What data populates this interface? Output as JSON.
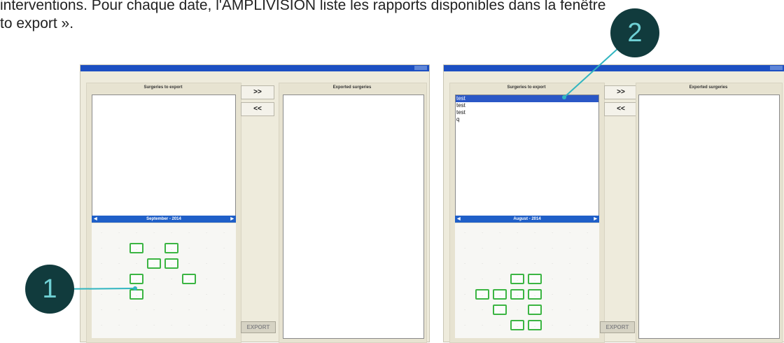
{
  "intro": {
    "line1": "interventions. Pour chaque date, l'AMPLIVISION liste les rapports disponibles dans la fenêtre",
    "line2": "to export »."
  },
  "callouts": {
    "one": "1",
    "two": "2"
  },
  "left_panel": {
    "surgeries_header": "Surgeries to export",
    "exported_header": "Exported surgeries",
    "add_button": ">>",
    "remove_button": "<<",
    "export_button": "EXPORT",
    "calendar_title": "September - 2014",
    "surgeries": []
  },
  "right_panel": {
    "surgeries_header": "Surgeries to export",
    "exported_header": "Exported surgeries",
    "add_button": ">>",
    "remove_button": "<<",
    "export_button": "EXPORT",
    "calendar_title": "August - 2014",
    "surgeries": [
      "test",
      "test",
      "test",
      "q"
    ]
  },
  "colors": {
    "titlebar": "#1c4fc2",
    "highlight": "#3cb543",
    "callout": "#113b3d",
    "callout_text": "#6fd0d4"
  }
}
